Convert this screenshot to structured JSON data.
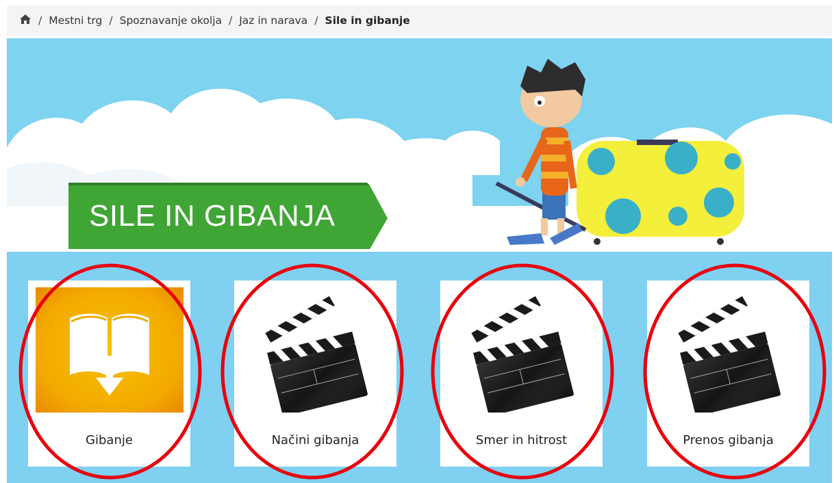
{
  "breadcrumb": {
    "home_icon": "home-icon",
    "items": [
      "Mestni trg",
      "Spoznavanje okolja",
      "Jaz in narava"
    ],
    "current": "Sile in gibanje"
  },
  "banner": {
    "title": "SILE IN GIBANJA",
    "colors": {
      "sky": "#7dd3f0",
      "title_bg": "#3fa535"
    }
  },
  "tiles": [
    {
      "label": "Gibanje",
      "icon": "book-download-icon"
    },
    {
      "label": "Načini gibanja",
      "icon": "clapperboard-icon"
    },
    {
      "label": "Smer in hitrost",
      "icon": "clapperboard-icon"
    },
    {
      "label": "Prenos gibanja",
      "icon": "clapperboard-icon"
    }
  ],
  "colors": {
    "tiles_bg": "#7fd0f1",
    "highlight": "#e8000d"
  }
}
